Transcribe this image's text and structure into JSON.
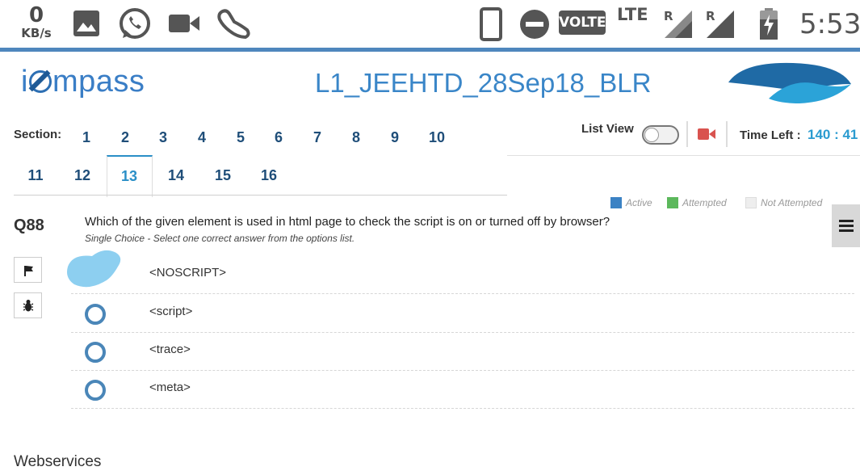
{
  "status_bar": {
    "net_speed_value": "0",
    "net_speed_unit": "KB/s",
    "volte": "VOLTE",
    "lte": "LTE",
    "roaming_1": "R",
    "roaming_2": "R",
    "time": "5:53",
    "icons": [
      "gallery-icon",
      "whatsapp-icon",
      "video-camera-icon",
      "shoe-icon",
      "phone-icon",
      "do-not-disturb-icon",
      "signal-icon",
      "battery-icon"
    ]
  },
  "header": {
    "logo_text_a": "i",
    "logo_text_b": "mpass",
    "exam_title": "L1_JEEHTD_28Sep18_BLR",
    "brand_color": "#1f6aa5"
  },
  "sections": {
    "label": "Section:",
    "items": [
      "1",
      "2",
      "3",
      "4",
      "5",
      "6",
      "7",
      "8",
      "9",
      "10",
      "11",
      "12",
      "13",
      "14",
      "15",
      "16"
    ],
    "active": "13"
  },
  "controls": {
    "list_view_label": "List View",
    "list_view_on": false,
    "time_left_label": "Time Left :",
    "time_left_value": "140 : 41"
  },
  "legend": {
    "active": "Active",
    "attempted": "Attempted",
    "not_attempted": "Not Attempted",
    "active_color": "#3b82c4",
    "attempted_color": "#5cb85c",
    "not_attempted_color": "#eeeeee"
  },
  "question": {
    "number": "Q88",
    "text": "Which of the given element is used in html page to check the script is on or turned off by browser?",
    "instruction": "Single Choice - Select one correct answer from the options list.",
    "options": [
      "<NOSCRIPT>",
      "<script>",
      "<trace>",
      "<meta>"
    ]
  },
  "footer": {
    "text": "Webservices"
  }
}
